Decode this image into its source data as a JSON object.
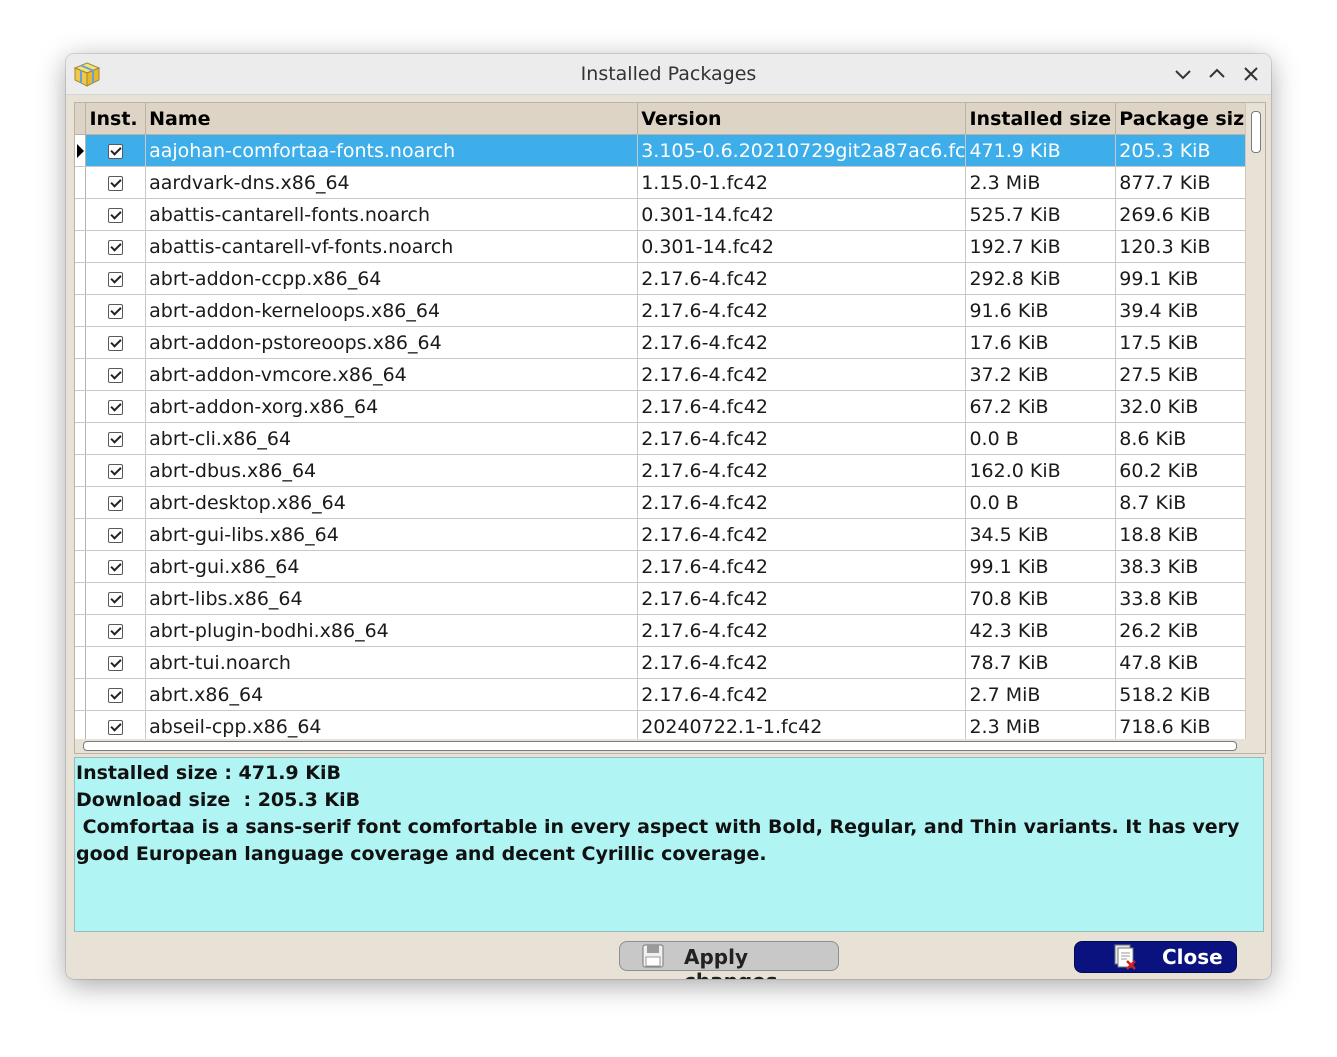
{
  "window": {
    "title": "Installed Packages"
  },
  "icons": {
    "app": "package-cube-icon",
    "minimize": "chevron-down-icon",
    "maximize": "chevron-up-icon",
    "close": "close-icon",
    "apply": "floppy-disk-icon",
    "close_button": "document-delete-icon"
  },
  "table": {
    "columns": [
      "Inst.",
      "Name",
      "Version",
      "Installed size",
      "Package size"
    ],
    "selected_index": 0,
    "rows": [
      {
        "inst": true,
        "name": "aajohan-comfortaa-fonts.noarch",
        "version": "3.105-0.6.20210729git2a87ac6.fc",
        "installed": "471.9 KiB",
        "package": "205.3 KiB"
      },
      {
        "inst": true,
        "name": "aardvark-dns.x86_64",
        "version": "1.15.0-1.fc42",
        "installed": "2.3 MiB",
        "package": "877.7 KiB"
      },
      {
        "inst": true,
        "name": "abattis-cantarell-fonts.noarch",
        "version": "0.301-14.fc42",
        "installed": "525.7 KiB",
        "package": "269.6 KiB"
      },
      {
        "inst": true,
        "name": "abattis-cantarell-vf-fonts.noarch",
        "version": "0.301-14.fc42",
        "installed": "192.7 KiB",
        "package": "120.3 KiB"
      },
      {
        "inst": true,
        "name": "abrt-addon-ccpp.x86_64",
        "version": "2.17.6-4.fc42",
        "installed": "292.8 KiB",
        "package": "99.1 KiB"
      },
      {
        "inst": true,
        "name": "abrt-addon-kerneloops.x86_64",
        "version": "2.17.6-4.fc42",
        "installed": "91.6 KiB",
        "package": "39.4 KiB"
      },
      {
        "inst": true,
        "name": "abrt-addon-pstoreoops.x86_64",
        "version": "2.17.6-4.fc42",
        "installed": "17.6 KiB",
        "package": "17.5 KiB"
      },
      {
        "inst": true,
        "name": "abrt-addon-vmcore.x86_64",
        "version": "2.17.6-4.fc42",
        "installed": "37.2 KiB",
        "package": "27.5 KiB"
      },
      {
        "inst": true,
        "name": "abrt-addon-xorg.x86_64",
        "version": "2.17.6-4.fc42",
        "installed": "67.2 KiB",
        "package": "32.0 KiB"
      },
      {
        "inst": true,
        "name": "abrt-cli.x86_64",
        "version": "2.17.6-4.fc42",
        "installed": "0.0   B",
        "package": "8.6 KiB"
      },
      {
        "inst": true,
        "name": "abrt-dbus.x86_64",
        "version": "2.17.6-4.fc42",
        "installed": "162.0 KiB",
        "package": "60.2 KiB"
      },
      {
        "inst": true,
        "name": "abrt-desktop.x86_64",
        "version": "2.17.6-4.fc42",
        "installed": "0.0   B",
        "package": "8.7 KiB"
      },
      {
        "inst": true,
        "name": "abrt-gui-libs.x86_64",
        "version": "2.17.6-4.fc42",
        "installed": "34.5 KiB",
        "package": "18.8 KiB"
      },
      {
        "inst": true,
        "name": "abrt-gui.x86_64",
        "version": "2.17.6-4.fc42",
        "installed": "99.1 KiB",
        "package": "38.3 KiB"
      },
      {
        "inst": true,
        "name": "abrt-libs.x86_64",
        "version": "2.17.6-4.fc42",
        "installed": "70.8 KiB",
        "package": "33.8 KiB"
      },
      {
        "inst": true,
        "name": "abrt-plugin-bodhi.x86_64",
        "version": "2.17.6-4.fc42",
        "installed": "42.3 KiB",
        "package": "26.2 KiB"
      },
      {
        "inst": true,
        "name": "abrt-tui.noarch",
        "version": "2.17.6-4.fc42",
        "installed": "78.7 KiB",
        "package": "47.8 KiB"
      },
      {
        "inst": true,
        "name": "abrt.x86_64",
        "version": "2.17.6-4.fc42",
        "installed": "2.7 MiB",
        "package": "518.2 KiB"
      },
      {
        "inst": true,
        "name": "abseil-cpp.x86_64",
        "version": "20240722.1-1.fc42",
        "installed": "2.3 MiB",
        "package": "718.6 KiB"
      }
    ]
  },
  "details": {
    "installed_size": "Installed size : 471.9 KiB",
    "download_size": "Download size  : 205.3 KiB",
    "description": " Comfortaa is a sans-serif font comfortable in every aspect with Bold, Regular, and Thin variants. It has very good European language coverage and decent Cyrillic coverage."
  },
  "buttons": {
    "apply": "Apply changes",
    "close": "Close"
  },
  "colors": {
    "selection": "#3daee9",
    "description_bg": "#b0f4f4",
    "close_button_bg": "#0a1280",
    "window_bg": "#e8e1d6"
  }
}
